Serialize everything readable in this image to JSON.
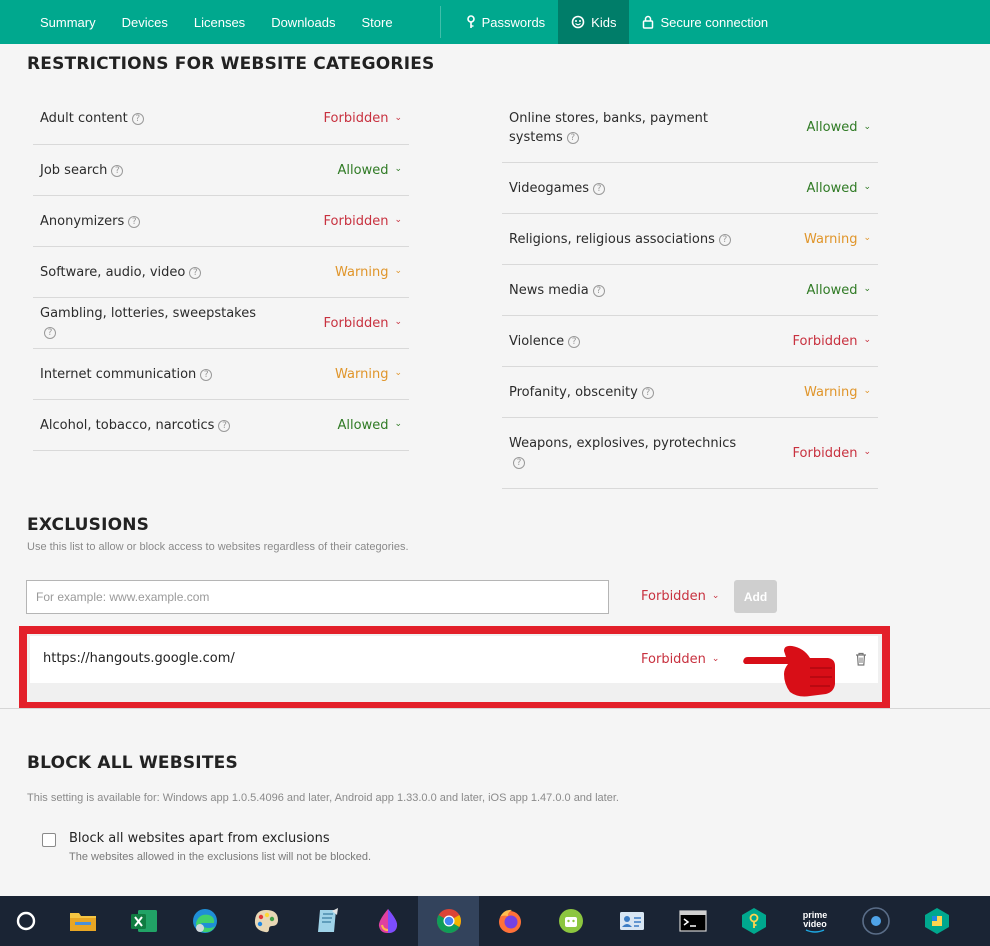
{
  "nav": {
    "items": [
      "Summary",
      "Devices",
      "Licenses",
      "Downloads",
      "Store"
    ],
    "right_items": [
      {
        "label": "Passwords",
        "icon": "key-icon",
        "active": false
      },
      {
        "label": "Kids",
        "icon": "kids-icon",
        "active": true
      },
      {
        "label": "Secure connection",
        "icon": "lock-icon",
        "active": false
      }
    ]
  },
  "restrictions": {
    "title": "RESTRICTIONS FOR WEBSITE CATEGORIES",
    "left": [
      {
        "label": "Adult content",
        "status": "Forbidden"
      },
      {
        "label": "Job search",
        "status": "Allowed"
      },
      {
        "label": "Anonymizers",
        "status": "Forbidden"
      },
      {
        "label": "Software, audio, video",
        "status": "Warning"
      },
      {
        "label": "Gambling, lotteries, sweepstakes",
        "status": "Forbidden"
      },
      {
        "label": "Internet communication",
        "status": "Warning"
      },
      {
        "label": "Alcohol, tobacco, narcotics",
        "status": "Allowed"
      }
    ],
    "right": [
      {
        "label": "Online stores, banks, payment systems",
        "status": "Allowed"
      },
      {
        "label": "Videogames",
        "status": "Allowed"
      },
      {
        "label": "Religions, religious associations",
        "status": "Warning"
      },
      {
        "label": "News media",
        "status": "Allowed"
      },
      {
        "label": "Violence",
        "status": "Forbidden"
      },
      {
        "label": "Profanity, obscenity",
        "status": "Warning"
      },
      {
        "label": "Weapons, explosives, pyrotechnics",
        "status": "Forbidden"
      }
    ]
  },
  "exclusions": {
    "title": "EXCLUSIONS",
    "description": "Use this list to allow or block access to websites regardless of their categories.",
    "input_placeholder": "For example: www.example.com",
    "input_status": "Forbidden",
    "add_label": "Add",
    "entries": [
      {
        "url": "https://hangouts.google.com/",
        "status": "Forbidden"
      }
    ]
  },
  "block_all": {
    "title": "BLOCK ALL WEBSITES",
    "description": "This setting is available for: Windows app 1.0.5.4096 and later, Android app 1.33.0.0 and later, iOS app 1.47.0.0 and later.",
    "checkbox_label": "Block all websites apart from exclusions",
    "checkbox_sub": "The websites allowed in the exclusions list will not be blocked.",
    "checked": false
  },
  "taskbar": {
    "icons": [
      "start-icon",
      "file-explorer-icon",
      "excel-icon",
      "edge-icon",
      "paint-icon",
      "notes-icon",
      "drop-icon",
      "chrome-icon",
      "firefox-icon",
      "android-emulator-icon",
      "contacts-icon",
      "terminal-icon",
      "kaspersky-password-icon",
      "prime-video-icon",
      "cortana-icon",
      "app-icon"
    ],
    "active_index": 7,
    "prime_text": [
      "prime",
      "video"
    ]
  },
  "colors": {
    "brand": "#00a88e",
    "forbidden": "#c8313f",
    "allowed": "#2f7a24",
    "warning": "#e0952a",
    "highlight": "#e3202a"
  }
}
